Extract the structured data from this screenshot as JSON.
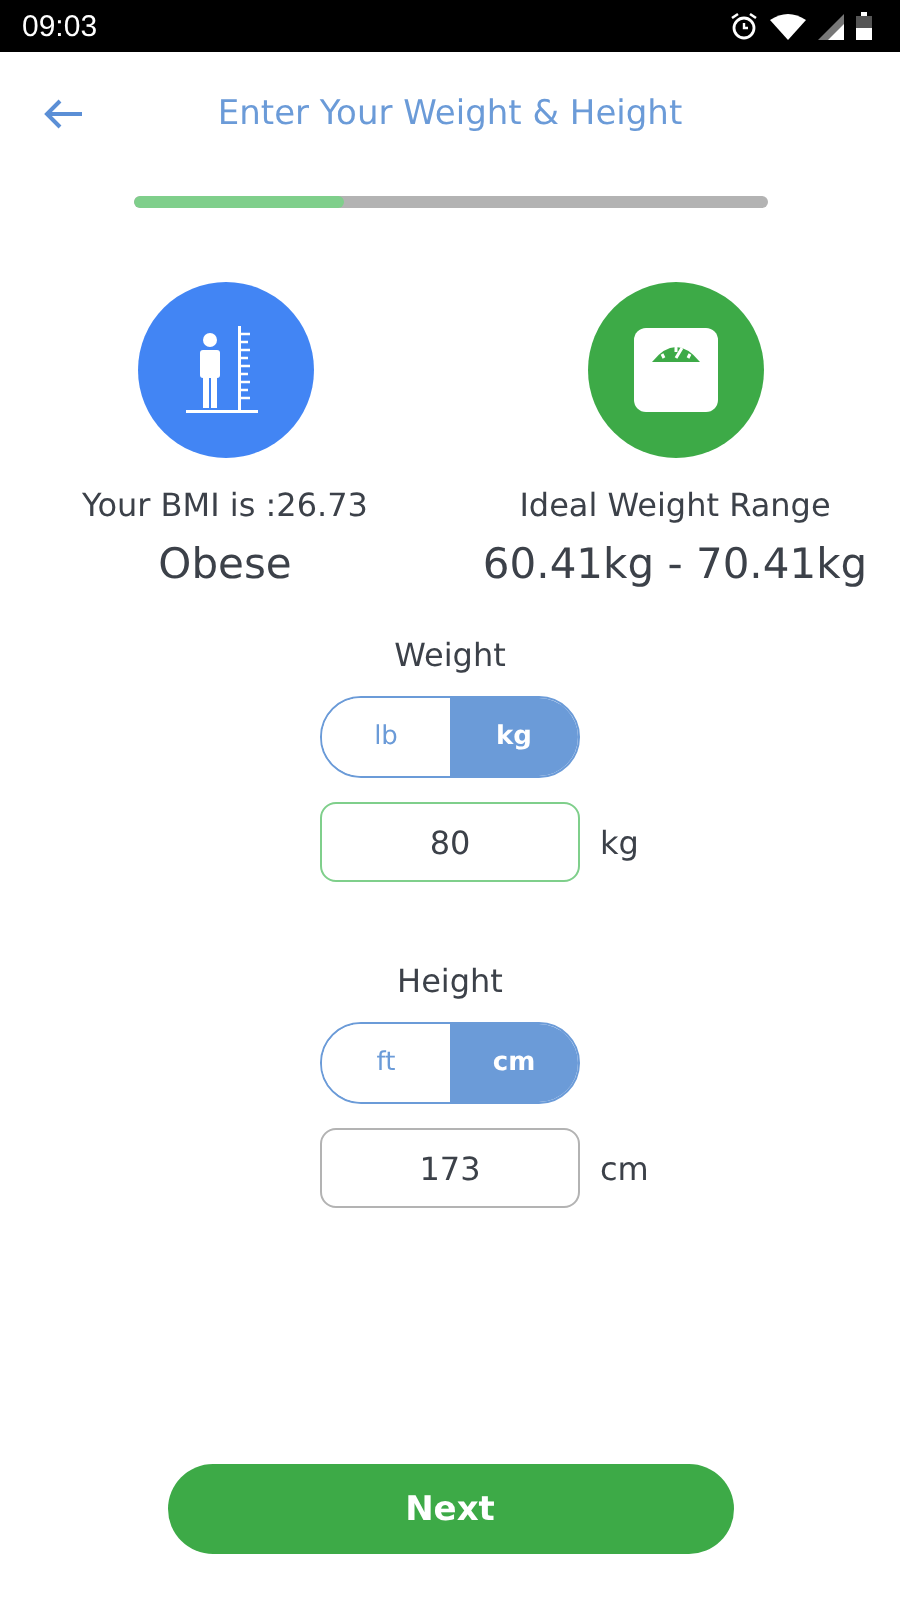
{
  "status_bar": {
    "time": "09:03"
  },
  "header": {
    "title": "Enter Your Weight & Height"
  },
  "progress": {
    "level": 0.334
  },
  "summary": [
    {
      "kind": "bmi",
      "label": "Your BMI is :26.73",
      "value": "Obese"
    },
    {
      "kind": "scale",
      "label": "Ideal Weight Range",
      "value": "60.41kg - 70.41kg"
    }
  ],
  "inputs": [
    {
      "label": "Weight",
      "units": [
        {
          "label": "lb",
          "selected": false
        },
        {
          "label": "kg",
          "selected": true
        }
      ],
      "value": "80",
      "unit": "kg",
      "focused": true
    },
    {
      "label": "Height",
      "units": [
        {
          "label": "ft",
          "selected": false
        },
        {
          "label": "cm",
          "selected": true
        }
      ],
      "value": "173",
      "unit": "cm",
      "focused": false
    }
  ],
  "next_button": {
    "label": "Next"
  }
}
